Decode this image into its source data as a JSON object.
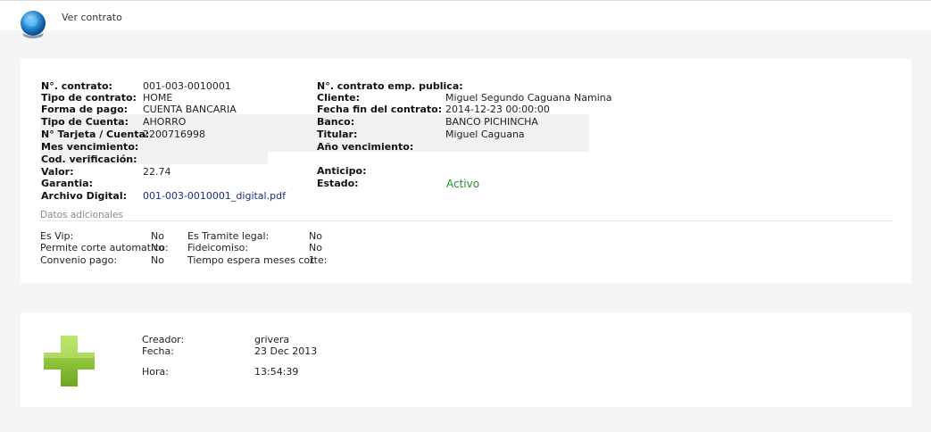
{
  "header": {
    "title": "Ver contrato",
    "icon": "globe-icon"
  },
  "contract": {
    "left": [
      {
        "label": "N°. contrato:",
        "value": "001-003-0010001"
      },
      {
        "label": "Tipo de contrato:",
        "value": "HOME"
      },
      {
        "label": "Forma de pago:",
        "value": "CUENTA BANCARIA"
      },
      {
        "label": "Tipo de Cuenta:",
        "value": "AHORRO"
      },
      {
        "label": "N° Tarjeta / Cuenta:",
        "value": "2200716998"
      },
      {
        "label": "Mes vencimiento:",
        "value": ""
      },
      {
        "label": "Cod. verificación:",
        "value": ""
      },
      {
        "label": "Valor:",
        "value": "22.74"
      },
      {
        "label": "Garantia:",
        "value": ""
      },
      {
        "label": "Archivo Digital:",
        "value": "001-003-0010001_digital.pdf"
      }
    ],
    "right": [
      {
        "label": "N°. contrato emp. publica:",
        "value": ""
      },
      {
        "label": "Cliente:",
        "value": "Miguel Segundo Caguana Namina"
      },
      {
        "label": "Fecha fin del contrato:",
        "value": "2014-12-23 00:00:00"
      },
      {
        "label": "Banco:",
        "value": "BANCO PICHINCHA"
      },
      {
        "label": "Titular:",
        "value": "Miguel Caguana"
      },
      {
        "label": "Año vencimiento:",
        "value": ""
      },
      {
        "label": "Anticipo:",
        "value": ""
      },
      {
        "label": "Estado:",
        "value": "Activo"
      }
    ]
  },
  "additional": {
    "title": "Datos adicionales",
    "left": [
      {
        "label": "Es Vip:",
        "value": "No"
      },
      {
        "label": "Permite corte automatico:",
        "value": "No"
      },
      {
        "label": "Convenio pago:",
        "value": "No"
      }
    ],
    "right": [
      {
        "label": "Es Tramite legal:",
        "value": "No"
      },
      {
        "label": "Fideicomiso:",
        "value": "No"
      },
      {
        "label": "Tiempo espera meses corte:",
        "value": "1"
      }
    ]
  },
  "creation": {
    "icon": "plus-icon",
    "creador_label": "Creador:",
    "creador": "grivera",
    "fecha_label": "Fecha:",
    "fecha": "23 Dec 2013",
    "hora_label": "Hora:",
    "hora": "13:54:39"
  },
  "colors": {
    "estado_active": "#2e8b2e",
    "link": "#1b2b8a",
    "plus_green": "#8cc63f"
  }
}
